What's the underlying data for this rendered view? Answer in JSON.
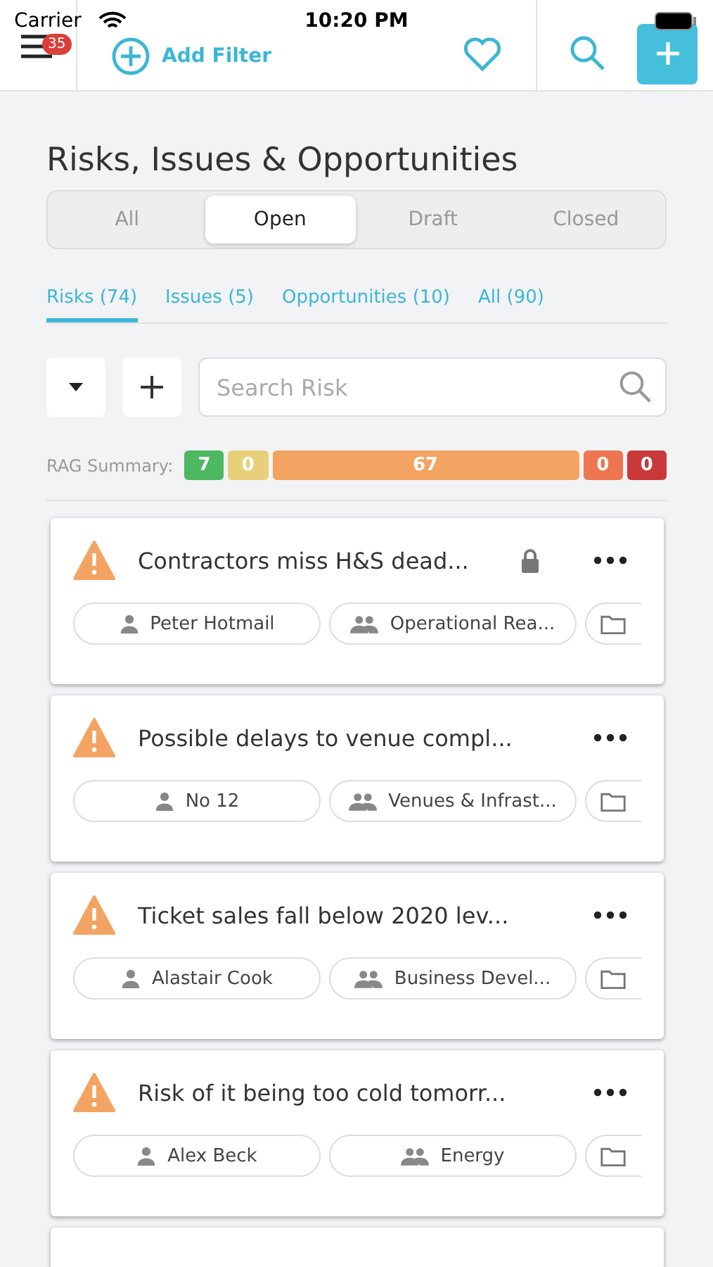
{
  "status_bar": {
    "carrier": "Carrier",
    "time": "10:20 PM"
  },
  "nav": {
    "badge": "35",
    "add_filter": "Add Filter"
  },
  "title": "Risks, Issues & Opportunities",
  "segments": [
    {
      "label": "All",
      "selected": false
    },
    {
      "label": "Open",
      "selected": true
    },
    {
      "label": "Draft",
      "selected": false
    },
    {
      "label": "Closed",
      "selected": false
    }
  ],
  "tabs": [
    {
      "label": "Risks (74)",
      "selected": true
    },
    {
      "label": "Issues (5)",
      "selected": false
    },
    {
      "label": "Opportunities (10)",
      "selected": false
    },
    {
      "label": "All (90)",
      "selected": false
    }
  ],
  "search": {
    "placeholder": "Search Risk"
  },
  "rag": {
    "label": "RAG Summary:",
    "segments": [
      {
        "value": "7",
        "color": "#4cb85f"
      },
      {
        "value": "0",
        "color": "#e8d07a"
      },
      {
        "value": "67",
        "color": "#f4a462"
      },
      {
        "value": "0",
        "color": "#ee7650"
      },
      {
        "value": "0",
        "color": "#c9393a"
      }
    ]
  },
  "cards": [
    {
      "title": "Contractors miss H&S dead...",
      "locked": true,
      "owner": "Peter Hotmail",
      "team": "Operational Rea..."
    },
    {
      "title": "Possible delays to venue compl...",
      "locked": false,
      "owner": "No 12",
      "team": "Venues & Infrast..."
    },
    {
      "title": "Ticket sales fall below 2020 lev...",
      "locked": false,
      "owner": "Alastair Cook",
      "team": "Business Devel..."
    },
    {
      "title": "Risk of it being too cold tomorr...",
      "locked": false,
      "owner": "Alex Beck",
      "team": "Energy"
    }
  ]
}
